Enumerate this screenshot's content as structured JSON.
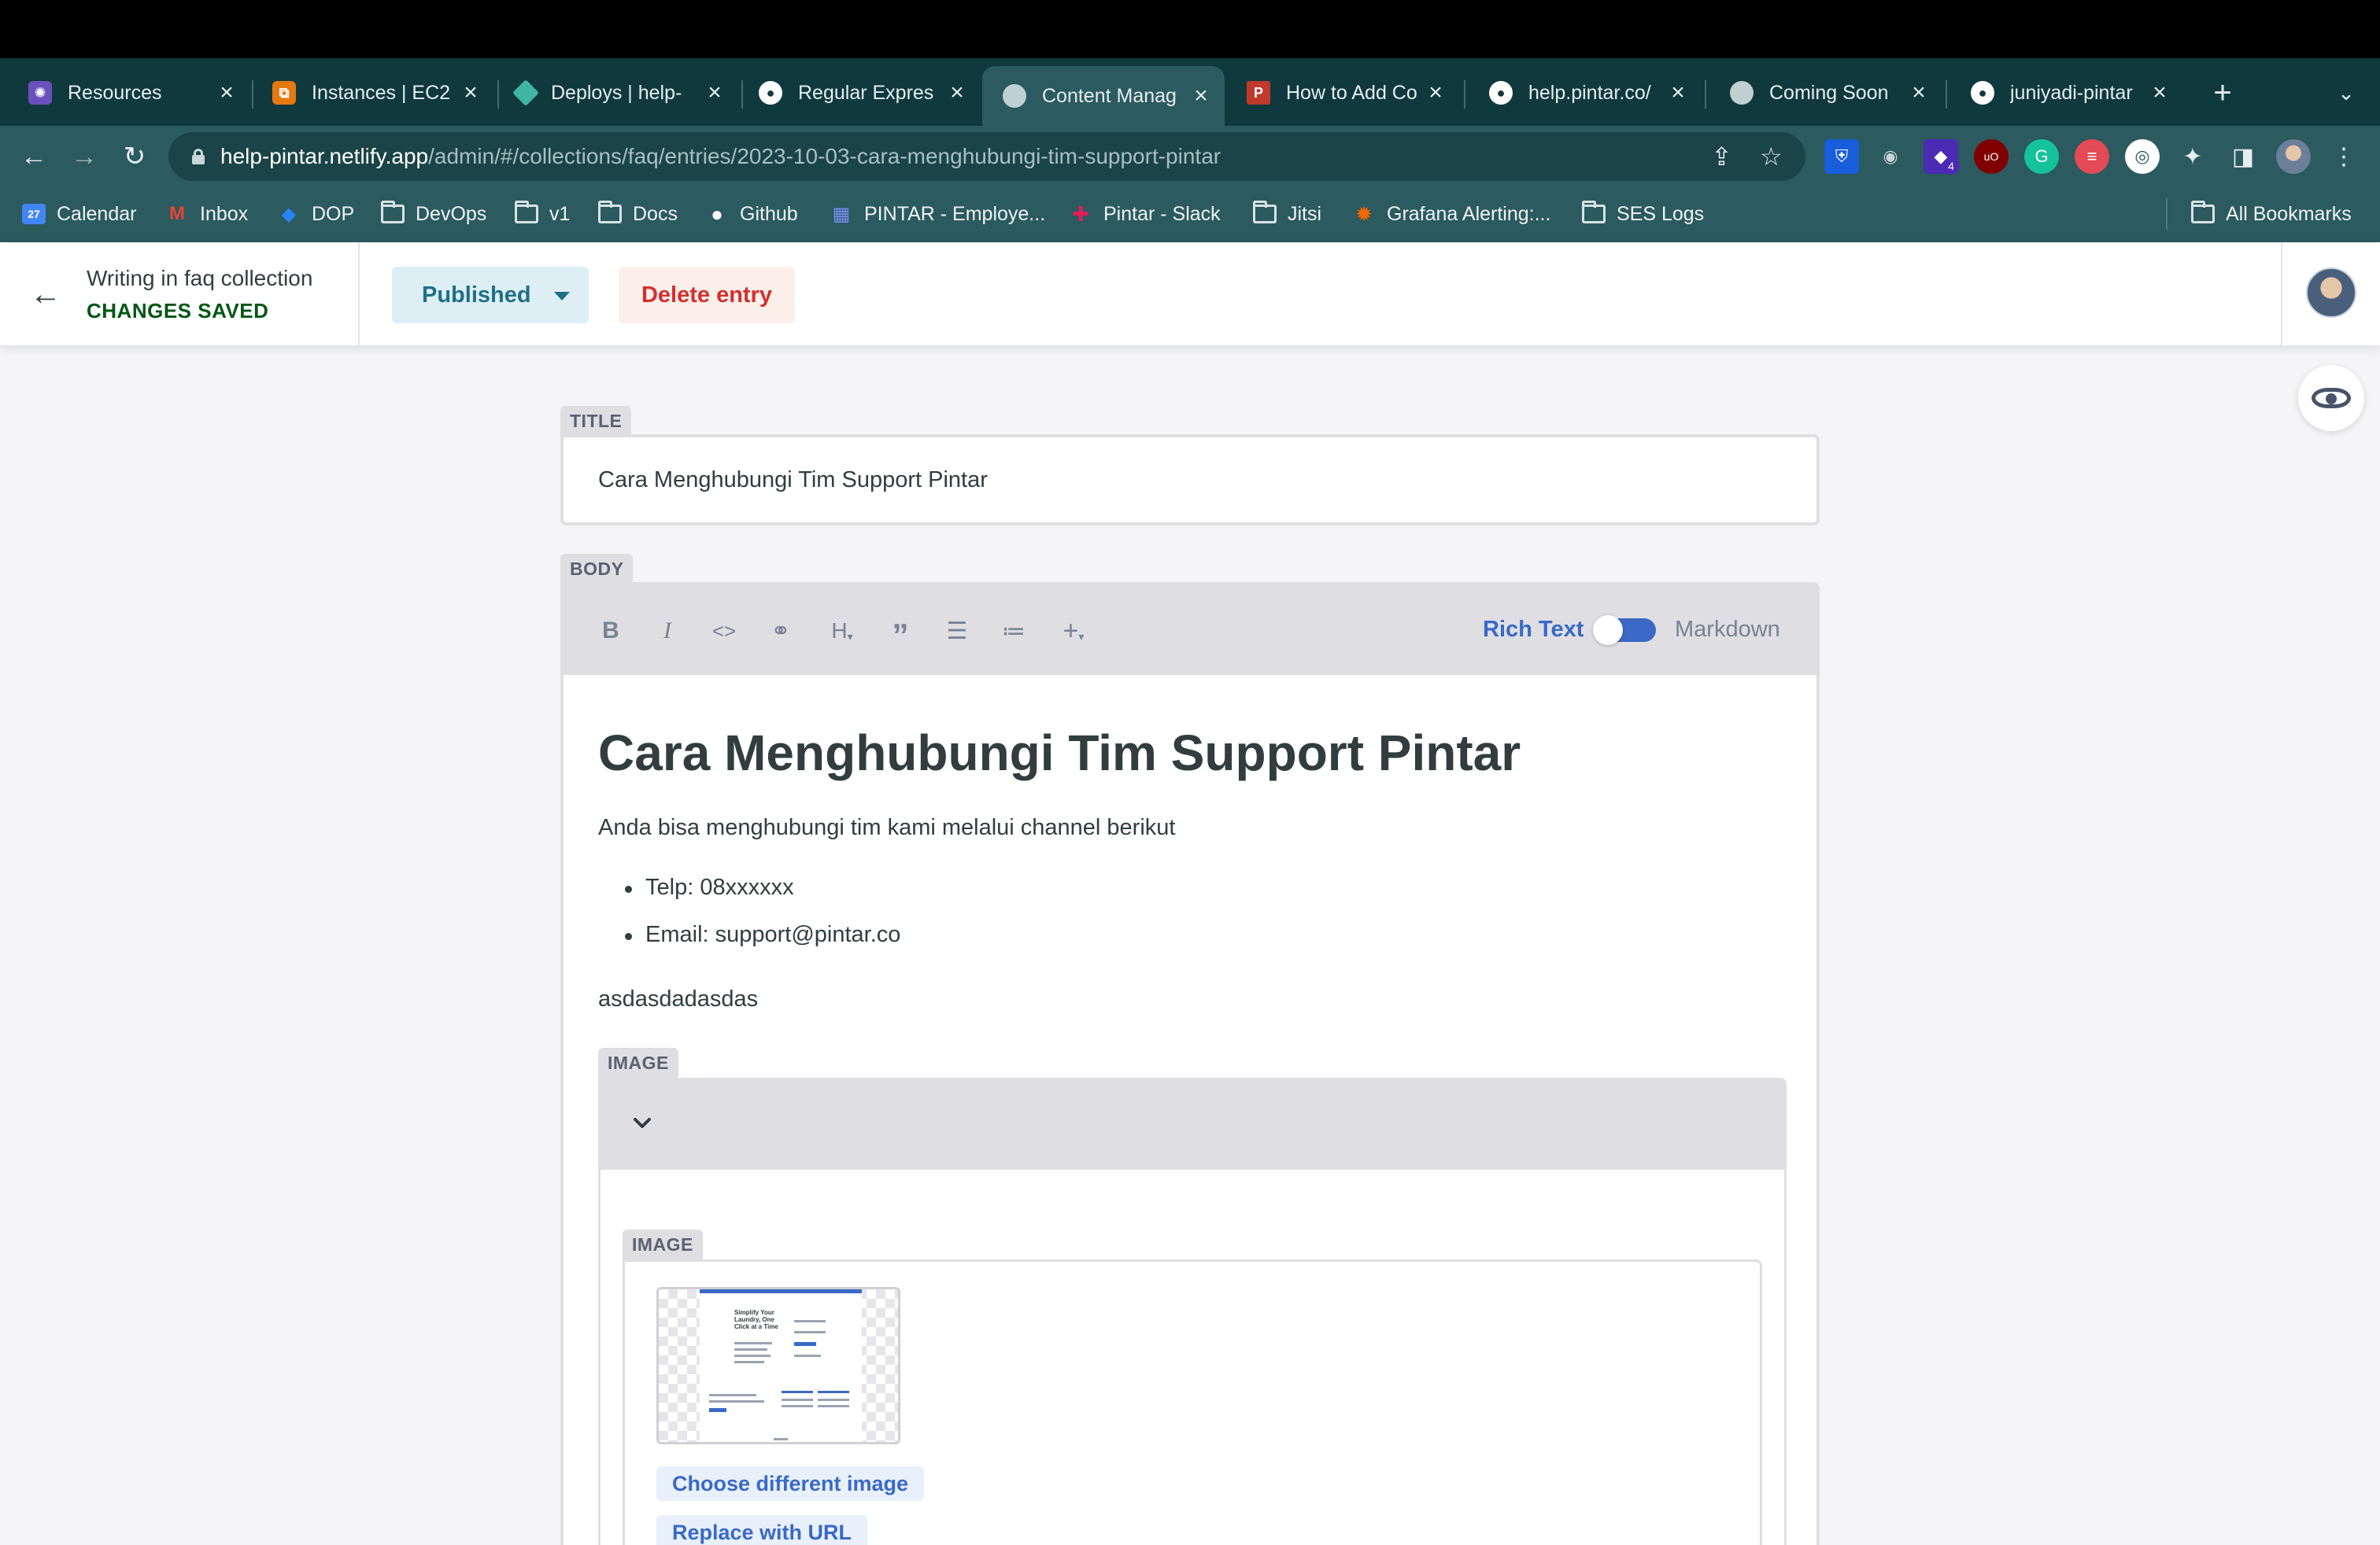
{
  "browser": {
    "tabs": [
      {
        "title": "Resources",
        "icon": "resources-icon",
        "color": "#6b4fbb"
      },
      {
        "title": "Instances | EC2",
        "icon": "aws-ec2-icon",
        "color": "#e47911"
      },
      {
        "title": "Deploys | help-",
        "icon": "netlify-icon",
        "color": "#3fb5a3"
      },
      {
        "title": "Regular Expres",
        "icon": "github-icon",
        "color": "#ffffff"
      },
      {
        "title": "Content Manag",
        "icon": "globe-icon",
        "color": "#c0cfd1"
      },
      {
        "title": "How to Add Co",
        "icon": "p-icon",
        "color": "#c0392b"
      },
      {
        "title": "help.pintar.co/",
        "icon": "github-icon",
        "color": "#ffffff"
      },
      {
        "title": "Coming Soon",
        "icon": "globe-icon",
        "color": "#c0cfd1"
      },
      {
        "title": "juniyadi-pintar",
        "icon": "github-icon",
        "color": "#ffffff"
      }
    ],
    "new_tab": "+",
    "url_host": "help-pintar.netlify.app",
    "url_path": "/admin/#/collections/faq/entries/2023-10-03-cara-menghubungi-tim-support-pintar",
    "extension_badge": "4",
    "bookmarks": [
      {
        "label": "Calendar",
        "icon": "calendar-icon"
      },
      {
        "label": "Inbox",
        "icon": "gmail-icon"
      },
      {
        "label": "DOP",
        "icon": "jira-icon"
      },
      {
        "label": "DevOps",
        "icon": "folder-icon"
      },
      {
        "label": "v1",
        "icon": "folder-icon"
      },
      {
        "label": "Docs",
        "icon": "folder-icon"
      },
      {
        "label": "Github",
        "icon": "github-icon"
      },
      {
        "label": "PINTAR - Employe...",
        "icon": "pintar-icon"
      },
      {
        "label": "Pintar - Slack",
        "icon": "slack-icon"
      },
      {
        "label": "Jitsi",
        "icon": "folder-icon"
      },
      {
        "label": "Grafana Alerting:...",
        "icon": "grafana-icon"
      },
      {
        "label": "SES Logs",
        "icon": "folder-icon"
      }
    ],
    "all_bookmarks": "All Bookmarks"
  },
  "header": {
    "writing_label": "Writing in faq collection",
    "status": "CHANGES SAVED",
    "publish_label": "Published",
    "delete_label": "Delete entry"
  },
  "editor": {
    "title_label": "TITLE",
    "title_value": "Cara Menghubungi Tim Support Pintar",
    "body_label": "BODY",
    "toolbar": {
      "rich_text": "Rich Text",
      "markdown": "Markdown"
    },
    "body": {
      "heading": "Cara Menghubungi Tim Support Pintar",
      "paragraph": "Anda bisa menghubungi tim kami melalui channel berikut",
      "list": [
        "Telp: 08xxxxxx",
        "Email: support@pintar.co"
      ],
      "extra": "asdasdadasdas"
    },
    "image_block_label": "IMAGE",
    "image_field_label": "IMAGE",
    "choose_image": "Choose different image",
    "replace_url": "Replace with URL",
    "thumb_heading": "Simplify Your Laundry, One Click at a Time"
  },
  "colors": {
    "tab_strip": "#10393d",
    "toolbar_bg": "#2b5a5f",
    "accent_blue": "#3a69c7",
    "saved_green": "#005614",
    "delete_red": "#d32f2f"
  }
}
